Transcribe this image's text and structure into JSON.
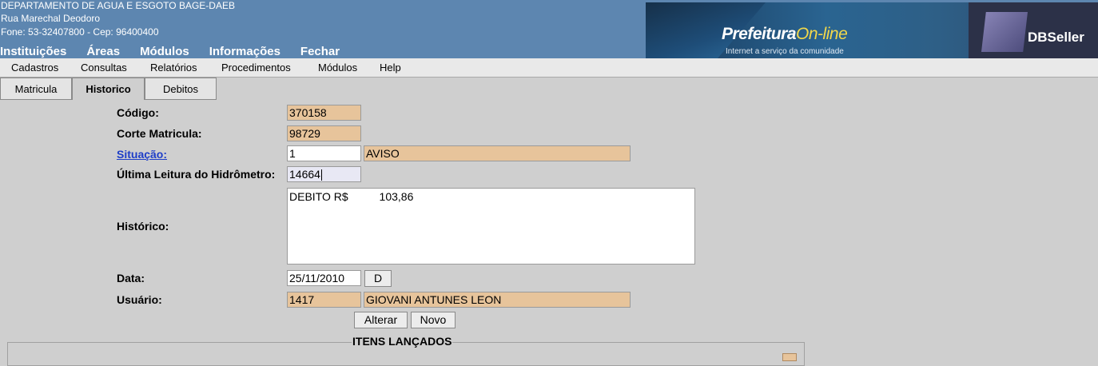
{
  "header": {
    "org_name": "DEPARTAMENTO DE AGUA E ESGOTO BAGE-DAEB",
    "org_address": "Rua Marechal Deodoro",
    "org_contact": "Fone: 53-32407800  -  Cep: 96400400",
    "main_menu": [
      "Instituições",
      "Áreas",
      "Módulos",
      "Informações",
      "Fechar"
    ],
    "banner_brand": "Prefeitura",
    "banner_brand_accent": "On-line",
    "banner_tagline": "Internet a serviço da comunidade",
    "vendor": "DBSeller"
  },
  "menubar": [
    "Cadastros",
    "Consultas",
    "Relatórios",
    "Procedimentos",
    "Módulos",
    "Help"
  ],
  "tabs": [
    {
      "label": "Matricula",
      "active": false
    },
    {
      "label": "Historico",
      "active": true
    },
    {
      "label": "Debitos",
      "active": false
    }
  ],
  "form": {
    "codigo_label": "Código:",
    "codigo_value": "370158",
    "corte_label": "Corte Matricula:",
    "corte_value": "98729",
    "situacao_label": "Situação:",
    "situacao_code": "1",
    "situacao_desc": "AVISO",
    "leitura_label": "Última Leitura do Hidrômetro:",
    "leitura_value": "14664",
    "historico_label": "Histórico:",
    "historico_value": "DEBITO R$          103,86",
    "data_label": "Data:",
    "data_value": "25/11/2010",
    "data_button": "D",
    "usuario_label": "Usuário:",
    "usuario_id": "1417",
    "usuario_name": "GIOVANI ANTUNES LEON",
    "alterar_button": "Alterar",
    "novo_button": "Novo"
  },
  "itens": {
    "title": "ITENS LANÇADOS"
  },
  "colors": {
    "header_bg": "#5d86b0",
    "readonly_field": "#e7c49b",
    "page_bg": "#cfcfcf",
    "link": "#1e3ec8"
  }
}
